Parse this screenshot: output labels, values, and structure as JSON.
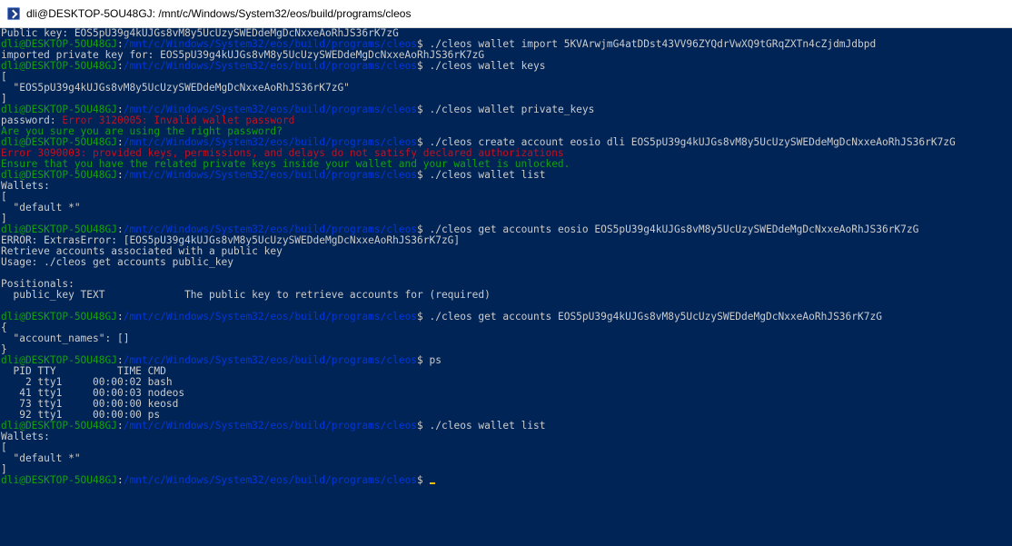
{
  "window": {
    "icon": "terminal-icon",
    "title": "dli@DESKTOP-5OU48GJ: /mnt/c/Windows/System32/eos/build/programs/cleos"
  },
  "prompt": {
    "user_host": "dli@DESKTOP-5OU48GJ",
    "path": "/mnt/c/Windows/System32/eos/build/programs/cleos"
  },
  "colors": {
    "background": "#012456",
    "text": "#cccccc",
    "prompt_user": "#13a10e",
    "prompt_path": "#0037da",
    "error": "#c50f1f",
    "warning": "#13a10e",
    "cursor": "#f2c200",
    "titlebar": "#ffffff"
  },
  "terminal": {
    "public_key_line": "Public key: EOS5pU39g4kUJGs8vM8y5UcUzySWEDdeMgDcNxxeAoRhJS36rK7zG",
    "cmd_import": "./cleos wallet import 5KVArwjmG4atDDst43VV96ZYQdrVwXQ9tGRqZXTn4cZjdmJdbpd",
    "imported_key": "imported private key for: EOS5pU39g4kUJGs8vM8y5UcUzySWEDdeMgDcNxxeAoRhJS36rK7zG",
    "cmd_keys": "./cleos wallet keys",
    "keys_open": "[",
    "keys_item": "  \"EOS5pU39g4kUJGs8vM8y5UcUzySWEDdeMgDcNxxeAoRhJS36rK7zG\"",
    "keys_close": "]",
    "cmd_private_keys": "./cleos wallet private_keys",
    "password_label": "password: ",
    "password_error": "Error 3120005: Invalid wallet password",
    "password_hint": "Are you sure you are using the right password?",
    "cmd_create_account": "./cleos create account eosio dli EOS5pU39g4kUJGs8vM8y5UcUzySWEDdeMgDcNxxeAoRhJS36rK7zG",
    "create_error": "Error 3090003: provided keys, permissions, and delays do not satisfy declared authorizations",
    "create_hint": "Ensure that you have the related private keys inside your wallet and your wallet is unlocked.",
    "cmd_list_1": "./cleos wallet list",
    "wallets_label_1": "Wallets:",
    "wallets_open_1": "[",
    "wallets_item_1": "  \"default *\"",
    "wallets_close_1": "]",
    "cmd_get_accounts_1": "./cleos get accounts eosio EOS5pU39g4kUJGs8vM8y5UcUzySWEDdeMgDcNxxeAoRhJS36rK7zG",
    "extras_error": "ERROR: ExtrasError: [EOS5pU39g4kUJGs8vM8y5UcUzySWEDdeMgDcNxxeAoRhJS36rK7zG]",
    "retrieve_desc": "Retrieve accounts associated with a public key",
    "usage": "Usage: ./cleos get accounts public_key",
    "positionals": "Positionals:",
    "positional_line": "  public_key TEXT             The public key to retrieve accounts for (required)",
    "cmd_get_accounts_2": "./cleos get accounts EOS5pU39g4kUJGs8vM8y5UcUzySWEDdeMgDcNxxeAoRhJS36rK7zG",
    "json_open": "{",
    "account_names": "  \"account_names\": []",
    "json_close": "}",
    "cmd_ps": "ps",
    "ps_header": "  PID TTY          TIME CMD",
    "ps_rows": [
      "    2 tty1     00:00:02 bash",
      "   41 tty1     00:00:03 nodeos",
      "   73 tty1     00:00:00 keosd",
      "   92 tty1     00:00:00 ps"
    ],
    "cmd_list_2": "./cleos wallet list",
    "wallets_label_2": "Wallets:",
    "wallets_open_2": "[",
    "wallets_item_2": "  \"default *\"",
    "wallets_close_2": "]",
    "prompt_symbol": "$ "
  }
}
